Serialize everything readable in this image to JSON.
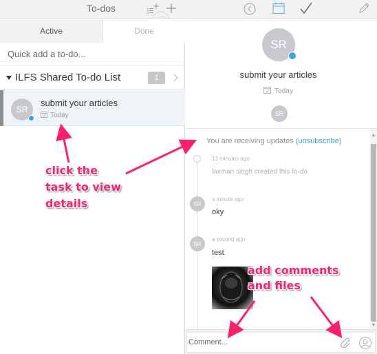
{
  "left_pane": {
    "header": {
      "title": "To-dos",
      "add_list_icon": "add-list-icon",
      "add_icon": "plus-icon"
    },
    "tabs": [
      {
        "label": "Active",
        "selected": true
      },
      {
        "label": "Done",
        "selected": false
      }
    ],
    "quick_add": {
      "placeholder": "Quick add a to-do...",
      "value": ""
    },
    "list": {
      "title": "ILFS Shared To-do List",
      "expanded": true,
      "count": "1",
      "tasks": [
        {
          "title": "submit your articles",
          "due": "Today",
          "assignee_initials": "SR",
          "selected": true
        }
      ]
    }
  },
  "right_pane": {
    "toolbar": {
      "icons": [
        "back-icon",
        "calendar-icon",
        "check-icon",
        "pencil-icon"
      ]
    },
    "detail": {
      "avatar_initials": "SR",
      "title": "submit your articles",
      "due": "Today",
      "assignee_initials": "SR"
    },
    "activity": {
      "subscription_text": "You are receiving updates (",
      "unsubscribe_label": "unsubscribe",
      "subscription_close": ")",
      "events": [
        {
          "time": "13 minutes ago",
          "text": "laxman singh created this to-do",
          "type": "system"
        },
        {
          "time": "a minute ago",
          "text": "oky",
          "type": "comment",
          "author_initials": "SR"
        },
        {
          "time": "a second ago",
          "text": "test",
          "type": "comment",
          "author_initials": "SR",
          "has_attachment": true
        }
      ]
    },
    "comment": {
      "placeholder": "Comment...",
      "value": "",
      "attach_icon": "paperclip-icon",
      "mention_icon": "person-icon"
    }
  },
  "annotations": {
    "task_hint": [
      "click the",
      "task to view",
      "details"
    ],
    "comment_hint": [
      "add comments",
      "and files"
    ],
    "color": "#ff1f6b"
  },
  "colors": {
    "accent_blue": "#3aa6e0",
    "link_blue": "#3f9fd3",
    "header_bg": "#f2f2f3",
    "selected_row_bg": "#eef4f7",
    "avatar_gray": "#c9c9cd"
  }
}
